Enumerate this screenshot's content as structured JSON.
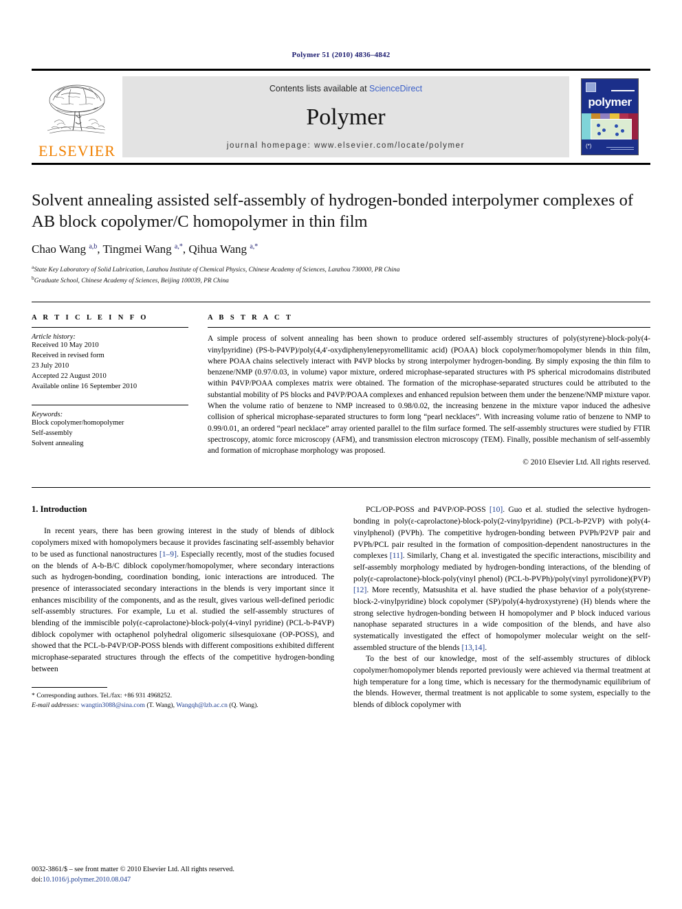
{
  "running_head": "Polymer 51 (2010) 4836–4842",
  "banner": {
    "publisher": "ELSEVIER",
    "contents_prefix": "Contents lists available at ",
    "sciencedirect": "ScienceDirect",
    "journal_name": "Polymer",
    "homepage": "journal homepage: www.elsevier.com/locate/polymer",
    "cover_title": "polymer"
  },
  "article": {
    "title": "Solvent annealing assisted self-assembly of hydrogen-bonded interpolymer complexes of AB block copolymer/C homopolymer in thin film",
    "authors_html": "Chao Wang <sup>a,b</sup>, Tingmei Wang <sup>a,*</sup>, Qihua Wang <sup>a,*</sup>",
    "affiliation_a": "State Key Laboratory of Solid Lubrication, Lanzhou Institute of Chemical Physics, Chinese Academy of Sciences, Lanzhou 730000, PR China",
    "affiliation_b": "Graduate School, Chinese Academy of Sciences, Beijing 100039, PR China"
  },
  "info": {
    "label": "A R T I C L E    I N F O",
    "history_head": "Article history:",
    "history": [
      "Received 10 May 2010",
      "Received in revised form",
      "23 July 2010",
      "Accepted 22 August 2010",
      "Available online 16 September 2010"
    ],
    "keywords_head": "Keywords:",
    "keywords": [
      "Block copolymer/homopolymer",
      "Self-assembly",
      "Solvent annealing"
    ]
  },
  "abstract": {
    "label": "A B S T R A C T",
    "text": "A simple process of solvent annealing has been shown to produce ordered self-assembly structures of poly(styrene)-block-poly(4-vinylpyridine)  (PS-b-P4VP)/poly(4,4′-oxydiphenylenepyromellitamic  acid) (POAA) block copolymer/homopolymer blends in thin film, where POAA chains selectively interact with P4VP blocks by strong interpolymer hydrogen-bonding. By simply exposing the thin film to benzene/NMP (0.97/0.03, in volume) vapor mixture, ordered microphase-separated structures with PS spherical microdomains distributed within P4VP/POAA complexes matrix were obtained. The formation of the microphase-separated structures could be attributed to the substantial mobility of PS blocks and P4VP/POAA complexes and enhanced repulsion between them under the benzene/NMP mixture vapor. When the volume ratio of benzene to NMP increased to 0.98/0.02, the increasing benzene in the mixture vapor induced the adhesive collision of spherical microphase-separated structures to form long “pearl necklaces”. With increasing volume ratio of benzene to NMP to 0.99/0.01, an ordered “pearl necklace” array oriented parallel to the film surface formed. The self-assembly structures were studied by FTIR spectroscopy, atomic force microscopy (AFM), and transmission electron microscopy (TEM). Finally, possible mechanism of self-assembly and formation of microphase morphology was proposed.",
    "copyright": "© 2010 Elsevier Ltd. All rights reserved."
  },
  "body": {
    "section_title": "1.  Introduction",
    "left_para_1_html": "In recent years, there has been growing interest in the study of blends of diblock copolymers mixed with homopolymers because it provides fascinating self-assembly behavior to be used as functional nanostructures <span class=\"ref\">[1–9]</span>. Especially recently, most of the studies focused on the blends of A-b-B/C diblock copolymer/homopolymer, where secondary interactions such as hydrogen-bonding, coordination bonding, ionic interactions are introduced. The presence of interassociated secondary interactions in the blends is very important since it enhances miscibility of the components, and as the result, gives various well-defined periodic self-assembly structures. For example, Lu et al. studied the self-assembly structures of blending of the immiscible poly(ε-caprolactone)-block-poly(4-vinyl pyridine) (PCL-b-P4VP) diblock copolymer with octaphenol polyhedral oligomeric silsesquioxane (OP-POSS), and showed that the PCL-b-P4VP/OP-POSS blends with different compositions exhibited different microphase-separated structures through the effects of the competitive hydrogen-bonding between",
    "right_para_1_html": "PCL/OP-POSS and P4VP/OP-POSS <span class=\"ref\">[10]</span>. Guo et al. studied the selective hydrogen-bonding in poly(ε-caprolactone)-block-poly(2-vinylpyridine) (PCL-b-P2VP) with poly(4-vinylphenol) (PVPh). The competitive hydrogen-bonding between PVPh/P2VP pair and PVPh/PCL pair resulted in the formation of composition-dependent nanostructures in the complexes <span class=\"ref\">[11]</span>. Similarly, Chang et al. investigated the specific interactions, miscibility and self-assembly morphology mediated by hydrogen-bonding interactions, of the blending of poly(ε-caprolactone)-block-poly(vinyl phenol) (PCL-b-PVPh)/poly(vinyl pyrrolidone)(PVP) <span class=\"ref\">[12]</span>. More recently, Matsushita et al. have studied the phase behavior of a poly(styrene-block-2-vinylpyridine) block copolymer (SP)/poly(4-hydroxystyrene) (H) blends where the strong selective hydrogen-bonding between H homopolymer and P block induced various nanophase separated structures in a wide composition of the blends, and have also systematically investigated the effect of homopolymer molecular weight on the self-assembled structure of the blends <span class=\"ref\">[13,14]</span>.",
    "right_para_2_html": "To the best of our knowledge, most of the self-assembly structures of diblock copolymer/homopolymer blends reported previously were achieved via thermal treatment at high temperature for a long time, which is necessary for the thermodynamic equilibrium of the blends. However, thermal treatment is not applicable to some system, especially to the blends of diblock copolymer with"
  },
  "footnote": {
    "corresponding_html": "* Corresponding authors. Tel./fax: +86 931 4968252.",
    "email_html": "<i>E-mail addresses:</i> <span class=\"email\">wangtin3088@sina.com</span> (T. Wang), <span class=\"email\">Wangqh@lzb.ac.cn</span> (Q. Wang)."
  },
  "imprint": {
    "line1": "0032-3861/$ – see front matter © 2010 Elsevier Ltd. All rights reserved.",
    "doi_prefix": "doi:",
    "doi": "10.1016/j.polymer.2010.08.047"
  }
}
